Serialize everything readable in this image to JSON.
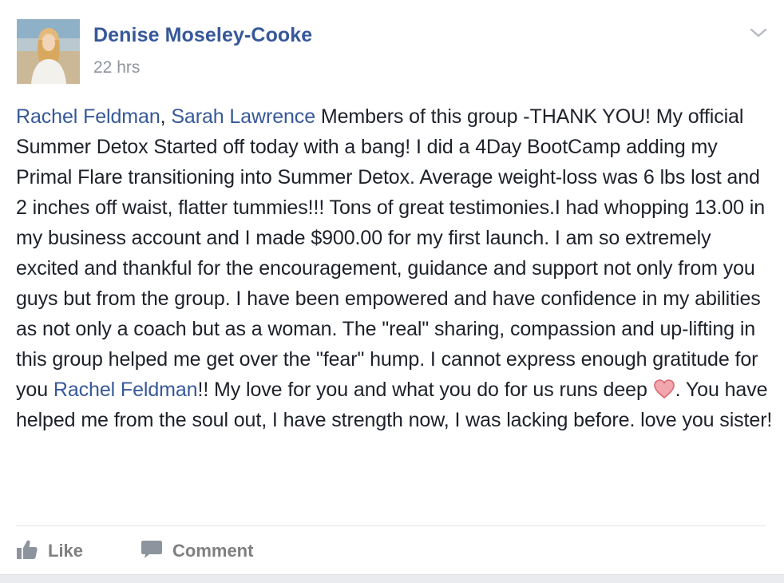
{
  "post": {
    "author_name": "Denise Moseley-Cooke",
    "timestamp": "22 hrs",
    "body": {
      "mention_1": "Rachel Feldman",
      "sep_1": ", ",
      "mention_2": "Sarah Lawrence",
      "text_1": " Members of this group -THANK YOU! My official Summer Detox Started off today with a bang! I did a 4Day BootCamp adding my Primal Flare transitioning into Summer Detox. Average weight-loss was 6 lbs lost and 2 inches off waist, flatter tummies!!! Tons of great testimonies.I had whopping 13.00 in my business account and I made $900.00 for my first launch. I am so extremely excited and thankful for the encouragement, guidance and support not only from you guys but from the group. I have been empowered and have confidence in my abilities as not only a coach but as a woman. The \"real\" sharing, compassion and up-lifting in this group helped me get over the \"fear\" hump. I cannot express enough gratitude for you ",
      "mention_3": "Rachel Feldman",
      "text_2": "!! My love for you and what you do for us runs deep ",
      "text_3": ". You have helped me from the soul out, I have strength now, I was lacking before. love you sister!"
    },
    "actions": {
      "like_label": "Like",
      "comment_label": "Comment"
    }
  },
  "colors": {
    "link": "#365899",
    "text": "#1d2129",
    "meta": "#90949c",
    "action": "#7f7f7f",
    "heart": "#e8868f"
  },
  "icons": {
    "menu": "chevron-down-icon",
    "like": "thumbs-up-icon",
    "comment": "speech-bubble-icon",
    "emoji": "heart-icon"
  }
}
